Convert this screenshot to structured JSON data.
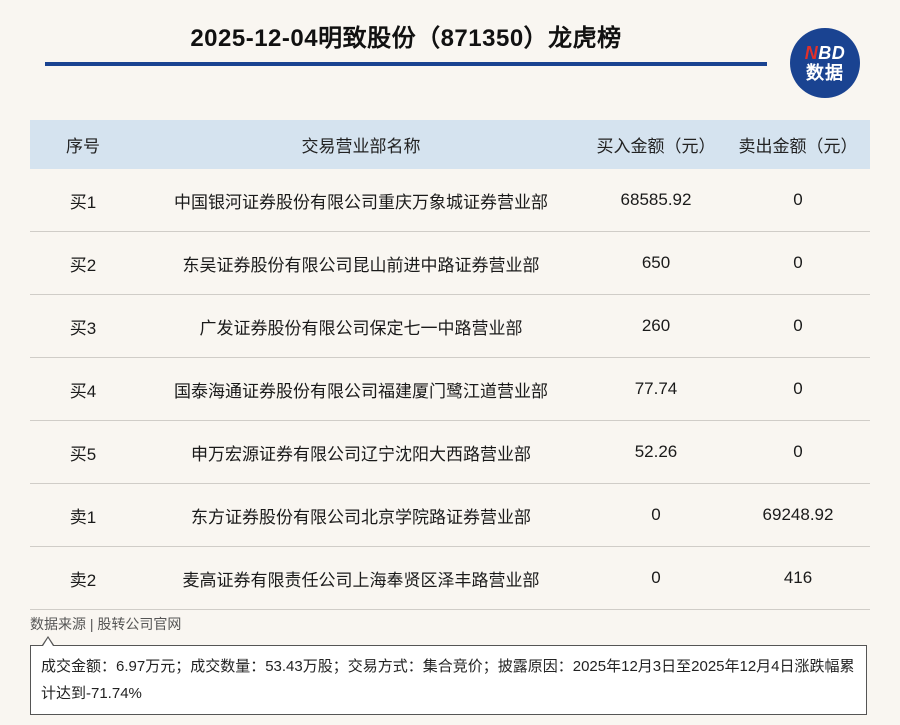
{
  "header": {
    "title": "2025-12-04明致股份（871350）龙虎榜",
    "logo_line1_n": "N",
    "logo_line1_rest": "BD",
    "logo_line2": "数据"
  },
  "table": {
    "columns": [
      "序号",
      "交易营业部名称",
      "买入金额（元）",
      "卖出金额（元）"
    ],
    "rows": [
      {
        "seq": "买1",
        "name": "中国银河证券股份有限公司重庆万象城证券营业部",
        "buy": "68585.92",
        "sell": "0"
      },
      {
        "seq": "买2",
        "name": "东吴证券股份有限公司昆山前进中路证券营业部",
        "buy": "650",
        "sell": "0"
      },
      {
        "seq": "买3",
        "name": "广发证券股份有限公司保定七一中路营业部",
        "buy": "260",
        "sell": "0"
      },
      {
        "seq": "买4",
        "name": "国泰海通证券股份有限公司福建厦门鹭江道营业部",
        "buy": "77.74",
        "sell": "0"
      },
      {
        "seq": "买5",
        "name": "申万宏源证券有限公司辽宁沈阳大西路营业部",
        "buy": "52.26",
        "sell": "0"
      },
      {
        "seq": "卖1",
        "name": "东方证券股份有限公司北京学院路证券营业部",
        "buy": "0",
        "sell": "69248.92"
      },
      {
        "seq": "卖2",
        "name": "麦高证券有限责任公司上海奉贤区泽丰路营业部",
        "buy": "0",
        "sell": "416"
      }
    ]
  },
  "footer": {
    "source": "数据来源 | 股转公司官网",
    "note": "成交金额：6.97万元；成交数量：53.43万股；交易方式：集合竞价；披露原因：2025年12月3日至2025年12月4日涨跌幅累计达到-71.74%"
  },
  "colors": {
    "brand_blue": "#1a4391",
    "header_bg": "#d5e3ef",
    "page_bg": "#f9f6f1",
    "logo_accent": "#e0302a"
  }
}
